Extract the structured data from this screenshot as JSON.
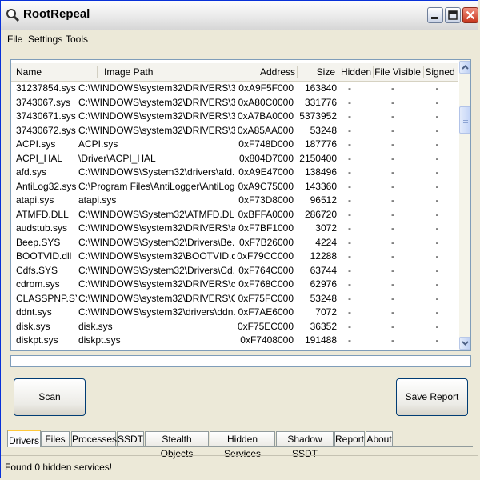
{
  "window": {
    "title": "RootRepeal"
  },
  "menu": [
    "File",
    "Settings",
    "Tools"
  ],
  "columns": [
    "Name",
    "Image Path",
    "Address",
    "Size",
    "Hidden",
    "File Visible",
    "Signed"
  ],
  "rows": [
    {
      "name": "31237854.sys",
      "path": "C:\\WINDOWS\\system32\\DRIVERS\\3...",
      "address": "0xA9F5F000",
      "size": "163840",
      "hidden": "-",
      "visible": "-",
      "signed": "-"
    },
    {
      "name": "3743067.sys",
      "path": "C:\\WINDOWS\\system32\\DRIVERS\\3...",
      "address": "0xA80C0000",
      "size": "331776",
      "hidden": "-",
      "visible": "-",
      "signed": "-"
    },
    {
      "name": "37430671.sys",
      "path": "C:\\WINDOWS\\system32\\DRIVERS\\3...",
      "address": "0xA7BA0000",
      "size": "5373952",
      "hidden": "-",
      "visible": "-",
      "signed": "-"
    },
    {
      "name": "37430672.sys",
      "path": "C:\\WINDOWS\\system32\\DRIVERS\\3...",
      "address": "0xA85AA000",
      "size": "53248",
      "hidden": "-",
      "visible": "-",
      "signed": "-"
    },
    {
      "name": "ACPI.sys",
      "path": "ACPI.sys",
      "address": "0xF748D000",
      "size": "187776",
      "hidden": "-",
      "visible": "-",
      "signed": "-"
    },
    {
      "name": "ACPI_HAL",
      "path": "\\Driver\\ACPI_HAL",
      "address": "0x804D7000",
      "size": "2150400",
      "hidden": "-",
      "visible": "-",
      "signed": "-"
    },
    {
      "name": "afd.sys",
      "path": "C:\\WINDOWS\\System32\\drivers\\afd...",
      "address": "0xA9E47000",
      "size": "138496",
      "hidden": "-",
      "visible": "-",
      "signed": "-"
    },
    {
      "name": "AntiLog32.sys",
      "path": "C:\\Program Files\\AntiLogger\\AntiLog...",
      "address": "0xA9C75000",
      "size": "143360",
      "hidden": "-",
      "visible": "-",
      "signed": "-"
    },
    {
      "name": "atapi.sys",
      "path": "atapi.sys",
      "address": "0xF73D8000",
      "size": "96512",
      "hidden": "-",
      "visible": "-",
      "signed": "-"
    },
    {
      "name": "ATMFD.DLL",
      "path": "C:\\WINDOWS\\System32\\ATMFD.DLL",
      "address": "0xBFFA0000",
      "size": "286720",
      "hidden": "-",
      "visible": "-",
      "signed": "-"
    },
    {
      "name": "audstub.sys",
      "path": "C:\\WINDOWS\\system32\\DRIVERS\\a...",
      "address": "0xF7BF1000",
      "size": "3072",
      "hidden": "-",
      "visible": "-",
      "signed": "-"
    },
    {
      "name": "Beep.SYS",
      "path": "C:\\WINDOWS\\System32\\Drivers\\Be...",
      "address": "0xF7B26000",
      "size": "4224",
      "hidden": "-",
      "visible": "-",
      "signed": "-"
    },
    {
      "name": "BOOTVID.dll",
      "path": "C:\\WINDOWS\\system32\\BOOTVID.dll",
      "address": "0xF79CC000",
      "size": "12288",
      "hidden": "-",
      "visible": "-",
      "signed": "-"
    },
    {
      "name": "Cdfs.SYS",
      "path": "C:\\WINDOWS\\System32\\Drivers\\Cd...",
      "address": "0xF764C000",
      "size": "63744",
      "hidden": "-",
      "visible": "-",
      "signed": "-"
    },
    {
      "name": "cdrom.sys",
      "path": "C:\\WINDOWS\\system32\\DRIVERS\\c...",
      "address": "0xF768C000",
      "size": "62976",
      "hidden": "-",
      "visible": "-",
      "signed": "-"
    },
    {
      "name": "CLASSPNP.SYS",
      "path": "C:\\WINDOWS\\system32\\DRIVERS\\C...",
      "address": "0xF75FC000",
      "size": "53248",
      "hidden": "-",
      "visible": "-",
      "signed": "-"
    },
    {
      "name": "ddnt.sys",
      "path": "C:\\WINDOWS\\system32\\drivers\\ddn...",
      "address": "0xF7AE6000",
      "size": "7072",
      "hidden": "-",
      "visible": "-",
      "signed": "-"
    },
    {
      "name": "disk.sys",
      "path": "disk.sys",
      "address": "0xF75EC000",
      "size": "36352",
      "hidden": "-",
      "visible": "-",
      "signed": "-"
    },
    {
      "name": "diskpt.sys",
      "path": "diskpt.sys",
      "address": "0xF7408000",
      "size": "191488",
      "hidden": "-",
      "visible": "-",
      "signed": "-"
    }
  ],
  "buttons": {
    "scan": "Scan",
    "save_report": "Save Report"
  },
  "tabs": [
    "Drivers",
    "Files",
    "Processes",
    "SSDT",
    "Stealth Objects",
    "Hidden Services",
    "Shadow SSDT",
    "Report",
    "About"
  ],
  "active_tab": "Drivers",
  "status": "Found 0 hidden services!"
}
